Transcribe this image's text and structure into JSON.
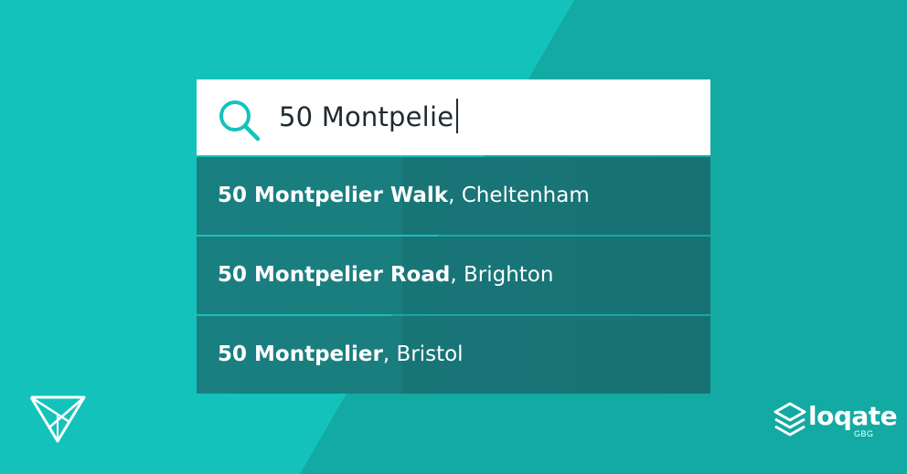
{
  "search": {
    "value": "50 Montpelie",
    "icon": "search-icon"
  },
  "results": [
    {
      "street": "50 Montpelier Walk",
      "city": "Cheltenham"
    },
    {
      "street": "50 Montpelier Road",
      "city": "Brighton"
    },
    {
      "street": "50 Montpelier",
      "city": "Bristol"
    }
  ],
  "separator": ", ",
  "branding": {
    "left_logo": "v-logo-icon",
    "right_logo_word": "loqate",
    "right_logo_sub": "GBG"
  },
  "colors": {
    "background_light": "#13c3bb",
    "background_dark": "#12aaa3",
    "result_bg": "#1a7d7e",
    "search_icon": "#13c3bb",
    "text_dark": "#1e2b30",
    "text_light": "#ffffff"
  }
}
